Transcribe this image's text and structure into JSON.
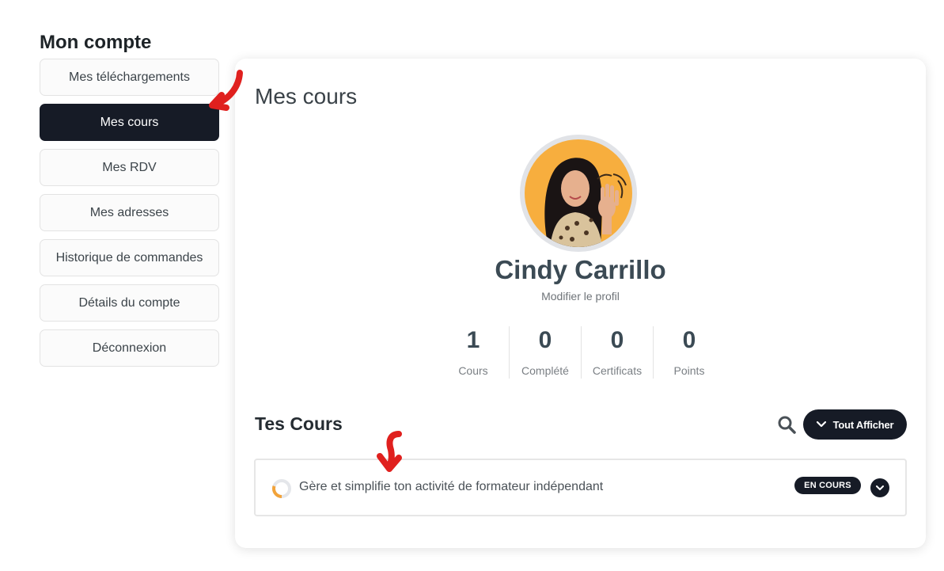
{
  "page": {
    "title": "Mon compte"
  },
  "sidebar": {
    "items": [
      {
        "label": "Mes téléchargements",
        "active": false
      },
      {
        "label": "Mes cours",
        "active": true
      },
      {
        "label": "Mes RDV",
        "active": false
      },
      {
        "label": "Mes adresses",
        "active": false
      },
      {
        "label": "Historique de commandes",
        "active": false
      },
      {
        "label": "Détails du compte",
        "active": false
      },
      {
        "label": "Déconnexion",
        "active": false
      }
    ]
  },
  "main": {
    "title": "Mes cours",
    "profile": {
      "name": "Cindy Carrillo",
      "edit_label": "Modifier le profil",
      "avatar_bg": "#f7ae3e"
    },
    "stats": [
      {
        "value": "1",
        "label": "Cours"
      },
      {
        "value": "0",
        "label": "Complété"
      },
      {
        "value": "0",
        "label": "Certificats"
      },
      {
        "value": "0",
        "label": "Points"
      }
    ],
    "courses_section": {
      "title": "Tes Cours",
      "search_icon": "search-icon",
      "show_all_label": "Tout Afficher"
    },
    "courses": [
      {
        "title": "Gère et simplifie ton activité de formateur indépendant",
        "status": "EN COURS",
        "progress": 0.3
      }
    ]
  },
  "colors": {
    "accent_dark": "#161b26",
    "progress_orange": "#f2a33a",
    "annotation_red": "#e0201e"
  }
}
